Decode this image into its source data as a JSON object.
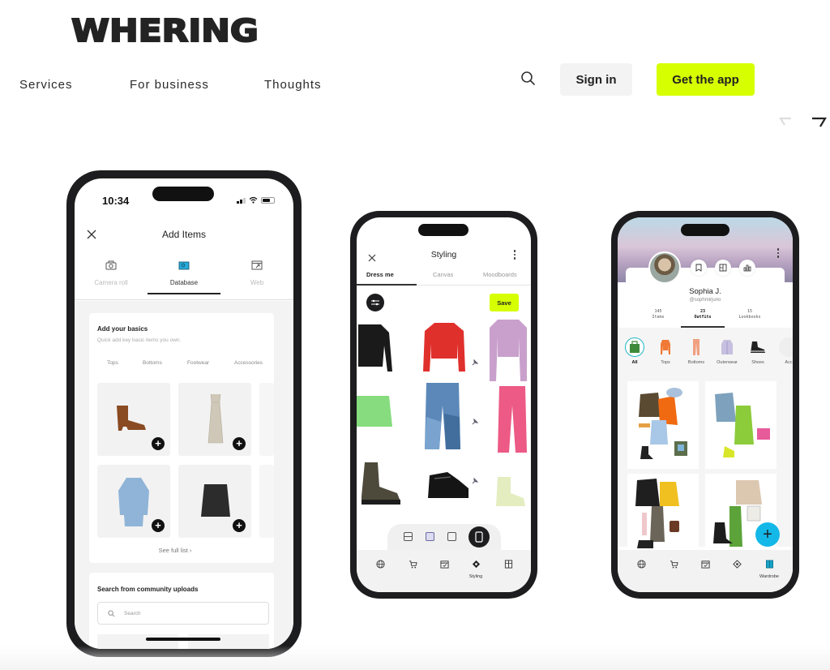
{
  "brand": {
    "logo_text": "WHERING",
    "accent_color": "#d6ff00"
  },
  "nav": {
    "links": [
      "Services",
      "For business",
      "Thoughts"
    ],
    "sign_in_label": "Sign in",
    "get_app_label": "Get the app"
  },
  "carousel": {
    "prev_icon": "arrow-left-icon",
    "next_icon": "arrow-right-icon"
  },
  "phone_add_items": {
    "status_time": "10:34",
    "title": "Add Items",
    "tabs": [
      {
        "label": "Camera roll",
        "icon": "camera-icon",
        "active": false
      },
      {
        "label": "Database",
        "icon": "database-icon",
        "active": true
      },
      {
        "label": "Web",
        "icon": "web-icon",
        "active": false
      }
    ],
    "basics_card": {
      "title": "Add your basics",
      "subtitle": "Quick add key basic items you own.",
      "categories": [
        "Tops",
        "Bottoms",
        "Footwear",
        "Accessories"
      ],
      "items": [
        {
          "name": "Brown ankle boot",
          "icon": "boot-icon"
        },
        {
          "name": "Beige slip dress",
          "icon": "dress-icon"
        },
        {
          "name": "Denim shirt dress",
          "icon": "shirt-icon"
        },
        {
          "name": "Black leather skirt",
          "icon": "skirt-icon"
        }
      ],
      "see_full_list": "See full list ›"
    },
    "community_card": {
      "title": "Search from community uploads",
      "search_placeholder": "Search"
    }
  },
  "phone_styling": {
    "title": "Styling",
    "tabs": [
      {
        "label": "Dress me",
        "active": true
      },
      {
        "label": "Canvas",
        "active": false
      },
      {
        "label": "Moodboards",
        "active": false
      }
    ],
    "save_label": "Save",
    "items": [
      {
        "name": "Black cardigan",
        "color": "#1a1a1a"
      },
      {
        "name": "Red knit top",
        "color": "#e0302c",
        "pinned": true
      },
      {
        "name": "Lilac cardigan",
        "color": "#c9a0cc"
      },
      {
        "name": "Green mini skirt",
        "color": "#86dc7e"
      },
      {
        "name": "Patchwork jeans",
        "color": "#5b88b8",
        "pinned": true
      },
      {
        "name": "Pink trousers",
        "color": "#ec5a85"
      },
      {
        "name": "Khaki chelsea boots",
        "color": "#4d4a3c"
      },
      {
        "name": "Black chunky sneakers",
        "color": "#151515",
        "pinned": true
      },
      {
        "name": "Pale lime boots",
        "color": "#e4edc0"
      }
    ],
    "bottom_nav": [
      {
        "label": "",
        "icon": "globe-icon"
      },
      {
        "label": "",
        "icon": "cart-icon"
      },
      {
        "label": "",
        "icon": "calendar-icon"
      },
      {
        "label": "Styling",
        "icon": "styling-icon",
        "active": true
      },
      {
        "label": "",
        "icon": "wardrobe-icon"
      }
    ]
  },
  "phone_profile": {
    "name": "Sophia J.",
    "handle": "@sophmirjuno",
    "stats": [
      {
        "value": "145",
        "label": "Items",
        "active": false
      },
      {
        "value": "23",
        "label": "Outfits",
        "active": true
      },
      {
        "value": "15",
        "label": "Lookbooks",
        "active": false
      }
    ],
    "categories": [
      {
        "label": "All",
        "color": "#3f8a3a",
        "active": true
      },
      {
        "label": "Tops",
        "color": "#f07a35"
      },
      {
        "label": "Bottoms",
        "color": "#f0a080"
      },
      {
        "label": "Outerwear",
        "color": "#c7c0e0"
      },
      {
        "label": "Shoes",
        "color": "#222222"
      },
      {
        "label": "Acc",
        "color": "#dddddd"
      }
    ],
    "outfits": [
      {
        "name": "Leather jacket & orange knit"
      },
      {
        "name": "Blue blazer & green dress"
      },
      {
        "name": "Black coat & yellow knit"
      },
      {
        "name": "Beige jumper & green skirt"
      }
    ],
    "fab_label": "+",
    "bottom_nav": [
      {
        "label": "",
        "icon": "globe-icon"
      },
      {
        "label": "",
        "icon": "cart-icon"
      },
      {
        "label": "",
        "icon": "calendar-icon"
      },
      {
        "label": "",
        "icon": "styling-icon"
      },
      {
        "label": "Wardrobe",
        "icon": "wardrobe-icon",
        "active": true
      }
    ]
  }
}
